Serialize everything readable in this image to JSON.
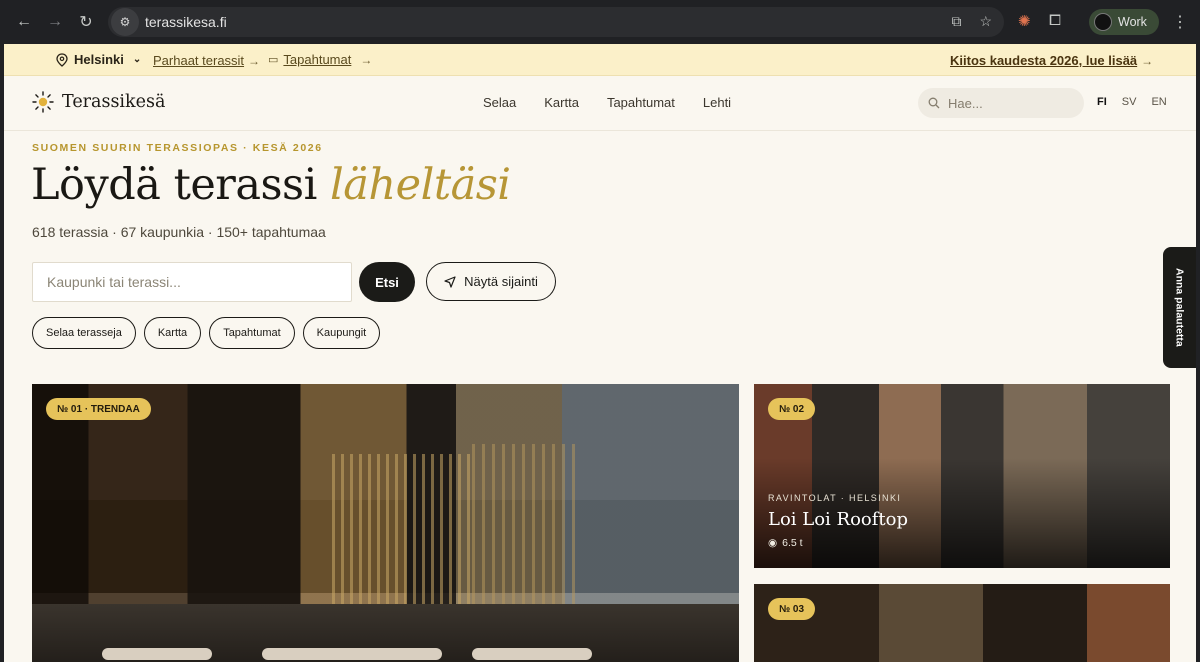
{
  "browser": {
    "url": "terassikesa.fi",
    "profile": "Work"
  },
  "topbar": {
    "city": "Helsinki",
    "link1": "Parhaat terassit",
    "link2": "Tapahtumat",
    "promo": "Kiitos kaudesta 2026, lue lisää"
  },
  "header": {
    "logo": "Terassikesä",
    "nav": [
      "Selaa",
      "Kartta",
      "Tapahtumat",
      "Lehti"
    ],
    "search_placeholder": "Hae...",
    "languages": [
      "FI",
      "SV",
      "EN"
    ]
  },
  "hero": {
    "eyebrow": "SUOMEN SUURIN TERASSIOPAS · KESÄ 2026",
    "title_plain": "Löydä terassi",
    "title_accent": "läheltäsi",
    "stats": "618 terassia · 67 kaupunkia · 150+ tapahtumaa",
    "search_placeholder": "Kaupunki tai terassi...",
    "search_button": "Etsi",
    "location_button": "Näytä sijainti",
    "chips": [
      "Selaa terasseja",
      "Kartta",
      "Tapahtumat",
      "Kaupungit"
    ]
  },
  "cards": [
    {
      "badge": "№ 01 · TRENDAA"
    },
    {
      "badge": "№ 02",
      "kicker": "RAVINTOLAT · HELSINKI",
      "title": "Loi Loi Rooftop",
      "views": "6.5 t"
    },
    {
      "badge": "№ 03"
    }
  ],
  "feedback": "Anna palautetta"
}
